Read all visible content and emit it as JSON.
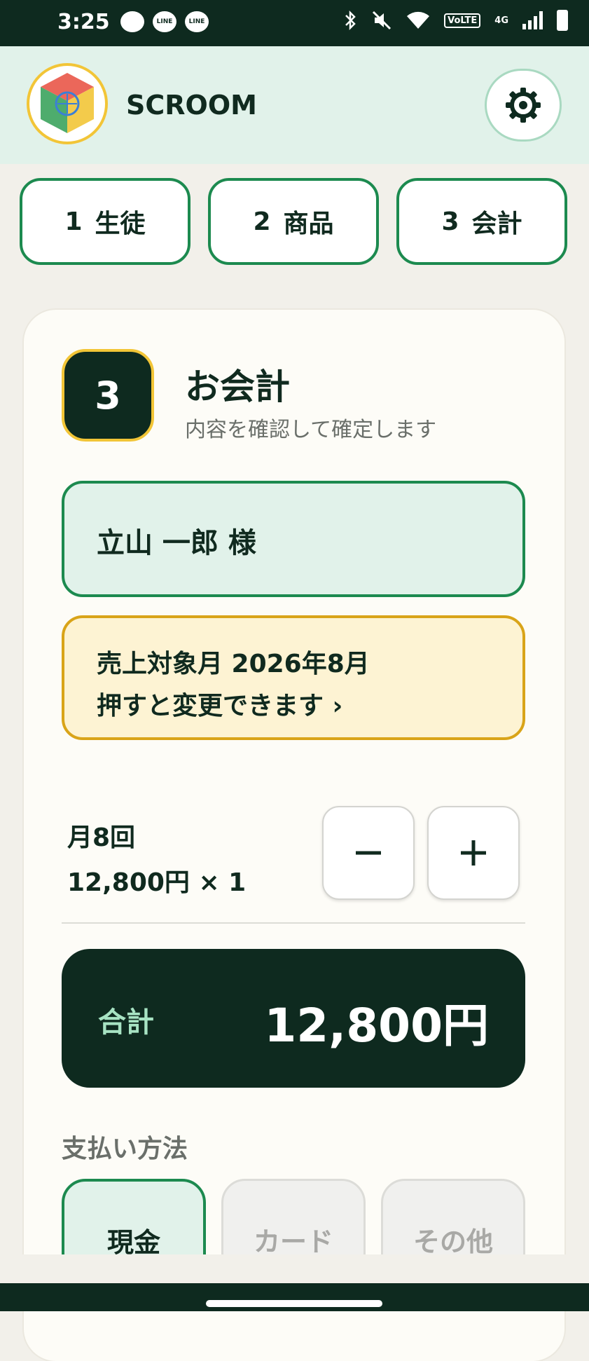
{
  "status_bar": {
    "time": "3:25",
    "notification_icons": [
      "",
      "LINE",
      "LINE"
    ],
    "network_badge": "VoLTE",
    "network_type": "4G"
  },
  "header": {
    "app_title": "SCROOM",
    "settings_icon": "gear-icon"
  },
  "steps": [
    {
      "number": "1",
      "label": "生徒"
    },
    {
      "number": "2",
      "label": "商品"
    },
    {
      "number": "3",
      "label": "会計"
    }
  ],
  "checkout": {
    "step_number": "3",
    "title": "お会計",
    "subtitle": "内容を確認して確定します",
    "customer_name": "立山 一郎 様",
    "sales_month_label": "売上対象月  2026年8月",
    "sales_month_hint": "押すと変更できます ›",
    "item": {
      "name": "月8回",
      "price_line": "12,800円 × 1"
    },
    "minus_label": "−",
    "plus_label": "+",
    "total_label": "合計",
    "total_value": "12,800円",
    "payment_label": "支払い方法",
    "payment_methods": [
      {
        "label": "現金",
        "selected": true
      },
      {
        "label": "カード",
        "selected": false
      },
      {
        "label": "その他",
        "selected": false
      }
    ]
  },
  "colors": {
    "dark_green": "#0e2a1f",
    "accent_green": "#1c8a4f",
    "mint": "#e1f2ea",
    "gold": "#d9a419"
  }
}
